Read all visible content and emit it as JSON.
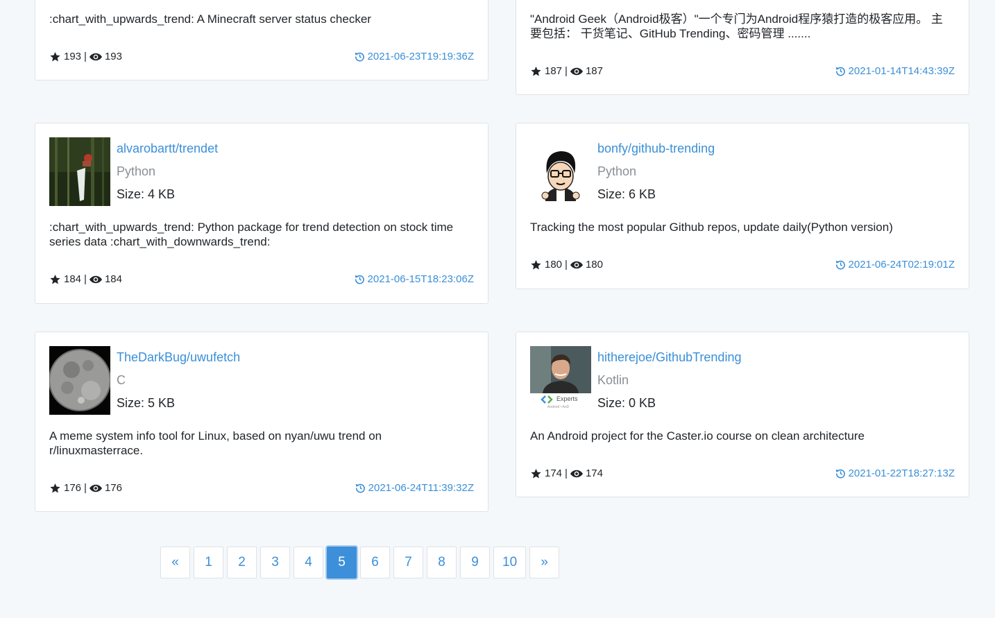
{
  "repos": [
    {
      "description": ":chart_with_upwards_trend: A Minecraft server status checker",
      "stars": "193",
      "watchers": "193",
      "separator": "|",
      "updated": "2021-06-23T19:19:36Z"
    },
    {
      "description": "\"Android Geek（Android极客）\"一个专门为Android程序猿打造的极客应用。 主要包括： 干货笔记、GitHub Trending、密码管理 .......",
      "stars": "187",
      "watchers": "187",
      "separator": "|",
      "updated": "2021-01-14T14:43:39Z"
    },
    {
      "name": "alvarobartt/trendet",
      "language": "Python",
      "size": "Size: 4 KB",
      "description": ":chart_with_upwards_trend: Python package for trend detection on stock time series data :chart_with_downwards_trend:",
      "stars": "184",
      "watchers": "184",
      "separator": "|",
      "updated": "2021-06-15T18:23:06Z"
    },
    {
      "name": "bonfy/github-trending",
      "language": "Python",
      "size": "Size: 6 KB",
      "description": "Tracking the most popular Github repos, update daily(Python version)",
      "stars": "180",
      "watchers": "180",
      "separator": "|",
      "updated": "2021-06-24T02:19:01Z"
    },
    {
      "name": "TheDarkBug/uwufetch",
      "language": "C",
      "size": "Size: 5 KB",
      "description": "A meme system info tool for Linux, based on nyan/uwu trend on r/linuxmasterrace.",
      "stars": "176",
      "watchers": "176",
      "separator": "|",
      "updated": "2021-06-24T11:39:32Z"
    },
    {
      "name": "hitherejoe/GithubTrending",
      "language": "Kotlin",
      "size": "Size: 0 KB",
      "description": "An Android project for the Caster.io course on clean architecture",
      "stars": "174",
      "watchers": "174",
      "separator": "|",
      "updated": "2021-01-22T18:27:13Z",
      "avatar_text": "Experts",
      "avatar_subtext": "Android • AoD"
    }
  ],
  "pagination": {
    "prev": "«",
    "next": "»",
    "pages": [
      "1",
      "2",
      "3",
      "4",
      "5",
      "6",
      "7",
      "8",
      "9",
      "10"
    ],
    "active": "5"
  },
  "colors": {
    "link": "#3a8fd8",
    "active_page": "#3d8fd9",
    "muted": "#8a8f94",
    "background": "#f5f8fa"
  },
  "icons": {
    "stars": "star-icon",
    "watchers": "eye-icon",
    "updated": "history-icon"
  }
}
